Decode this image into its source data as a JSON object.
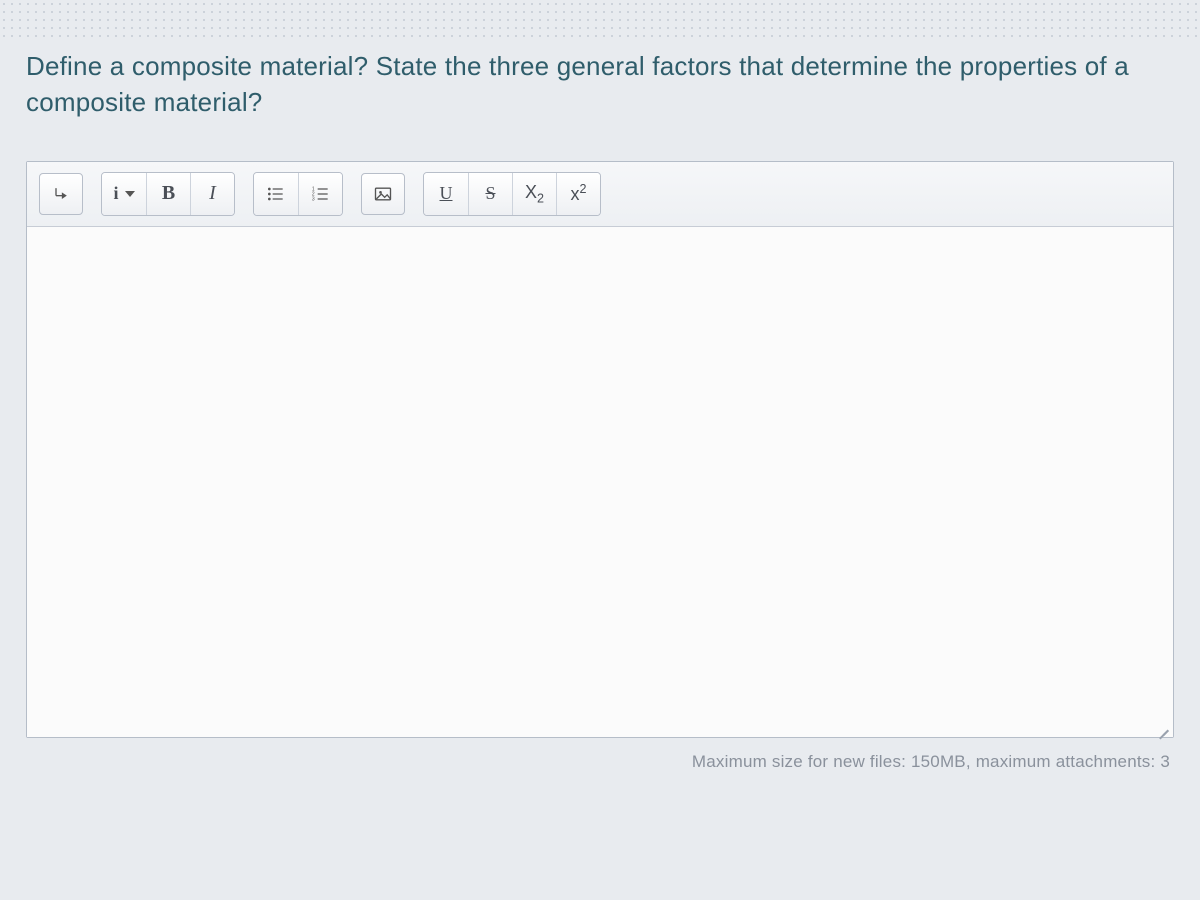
{
  "question": {
    "text": "Define a composite material? State the three general factors that determine the properties of a composite material?"
  },
  "toolbar": {
    "paragraph_direction_label": "↴",
    "info_label": "i",
    "bold_label": "B",
    "italic_label": "I",
    "underline_label": "U",
    "strike_label": "S",
    "subscript_label": "X",
    "subscript_sub": "2",
    "superscript_label": "x",
    "superscript_sup": "2"
  },
  "footer": {
    "text": "Maximum size for new files: 150MB, maximum attachments: 3"
  }
}
